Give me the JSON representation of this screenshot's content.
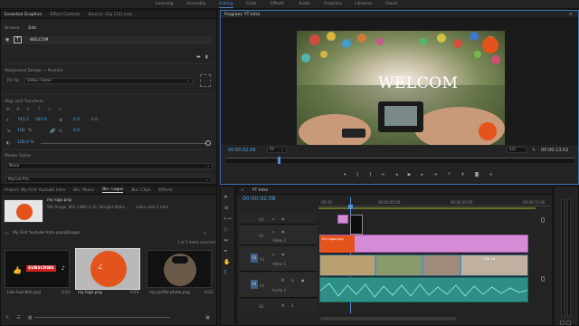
{
  "workspaces": [
    "Learning",
    "Assembly",
    "Editing",
    "Color",
    "Effects",
    "Audio",
    "Graphics",
    "Libraries",
    "Cloud"
  ],
  "workspace_active": "Editing",
  "left_tabs": [
    "Essential Graphics",
    "Effect Controls",
    "Source: Clip [13].mov"
  ],
  "eg": {
    "subtabs": [
      "Browse",
      "Edit"
    ],
    "layer_name": "WELCOM",
    "responsive_label": "Responsive Design — Position",
    "pin_label": "Pin To:",
    "pin_value": "Video Frame",
    "align_label": "Align and Transform",
    "pos_x": "741.2",
    "pos_y": "587.6",
    "anchor_x": "0.0",
    "anchor_y": "0.0",
    "scale": "100",
    "scale_pct": "%",
    "rot": "0.0",
    "opacity": "100.0 %",
    "master_styles_label": "Master Styles",
    "master_styles_value": "None",
    "text_label": "Text",
    "font_value": "Myriad Pro"
  },
  "program": {
    "title": "Program: YT Intro",
    "video_text": "WELCOM",
    "timecode_left": "00:00:02:08",
    "fit": "Fit",
    "fraction": "1/2",
    "timecode_right": "00:00:13:02"
  },
  "project": {
    "tabs": [
      "Project: My First Youtube Intro",
      "Bin: Music",
      "Bin: Logos",
      "Bin: Clips",
      "Effects"
    ],
    "active_tab": "Bin: Logos",
    "file_name": "my logo.png",
    "file_info1": "Still Image, 801 x 800 (1.0), Straight Alpha",
    "file_info2": "video used 1 time",
    "path": "My First Youtube Intro.prproj\\Logos",
    "items_selected": "1 of 3 items selected",
    "items": [
      {
        "name": "Like Sub Bell.png",
        "duration": "0:23",
        "badge": "SUBSCRIBE"
      },
      {
        "name": "my logo.png",
        "duration": "0:23",
        "badge": ""
      },
      {
        "name": "my profile photo.png",
        "duration": "0:23",
        "badge": ""
      }
    ]
  },
  "timeline": {
    "seq_name": "YT Intro",
    "timecode": "00:00:02:08",
    "ruler": [
      ":00:00",
      "00:00:05:00",
      "00:00:10:00",
      "00:00:15:00"
    ],
    "tracks": [
      {
        "id": "V3",
        "name": ""
      },
      {
        "id": "V2",
        "name": "Video 2"
      },
      {
        "id": "V1",
        "name": "Video 1"
      },
      {
        "id": "A1",
        "name": "Audio 1"
      },
      {
        "id": "A2",
        "name": ""
      }
    ],
    "v2_clip_label": "my logo.png",
    "v1_clip_label": "Clip 19"
  },
  "colors": {
    "accent_blue": "#4f8fd9",
    "timecode_blue": "#4fa3e3",
    "graphic_clip": "#d68bd6",
    "video_clip": "#5b8fb0",
    "audio_clip": "#2f8f86",
    "subscribe_red": "#d42020",
    "logo_orange": "#e4531b"
  }
}
